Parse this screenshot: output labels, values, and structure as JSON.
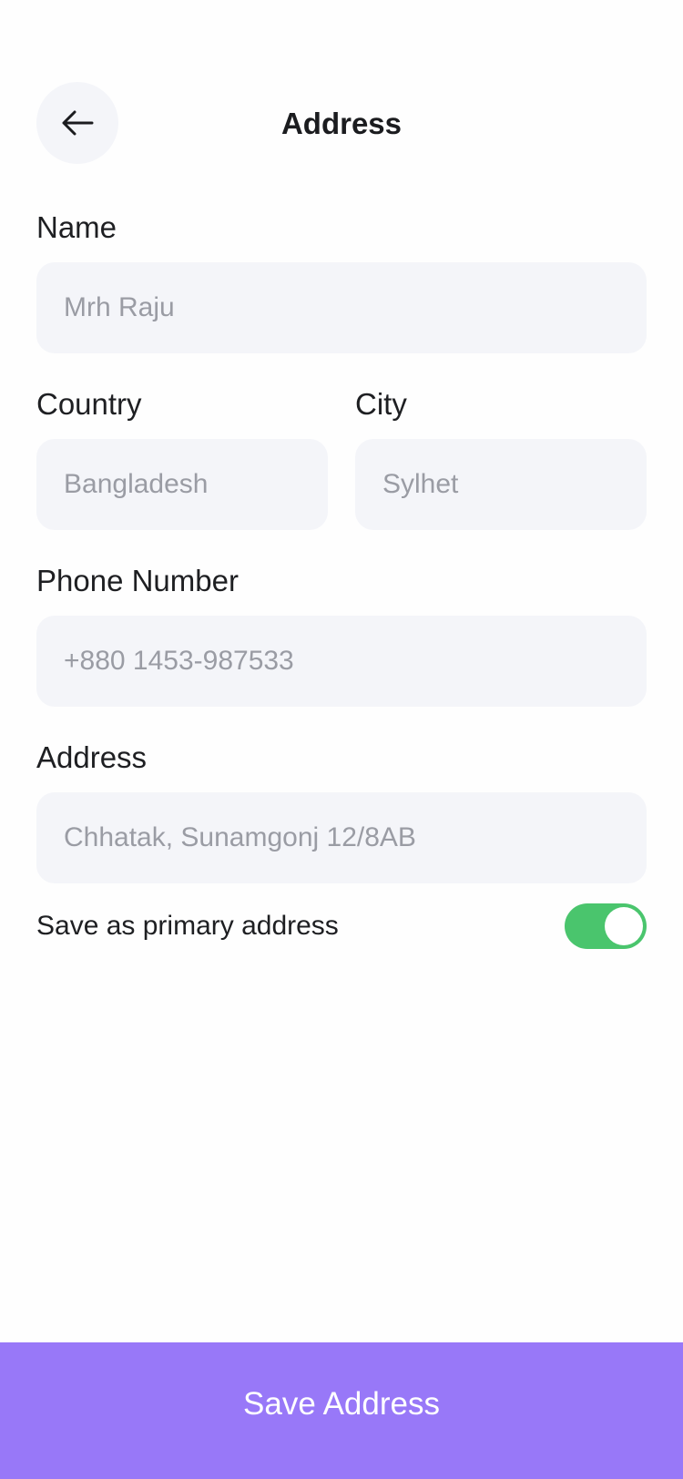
{
  "header": {
    "title": "Address",
    "back_icon": "arrow-left-icon"
  },
  "form": {
    "name": {
      "label": "Name",
      "value": "Mrh Raju"
    },
    "country": {
      "label": "Country",
      "value": "Bangladesh"
    },
    "city": {
      "label": "City",
      "value": "Sylhet"
    },
    "phone": {
      "label": "Phone Number",
      "value": "+880 1453-987533"
    },
    "address": {
      "label": "Address",
      "value": "Chhatak, Sunamgonj 12/8AB"
    }
  },
  "primary_toggle": {
    "label": "Save as primary address",
    "on": true,
    "color": "#4ac56d"
  },
  "footer": {
    "save_label": "Save Address",
    "color": "#9878f8"
  }
}
